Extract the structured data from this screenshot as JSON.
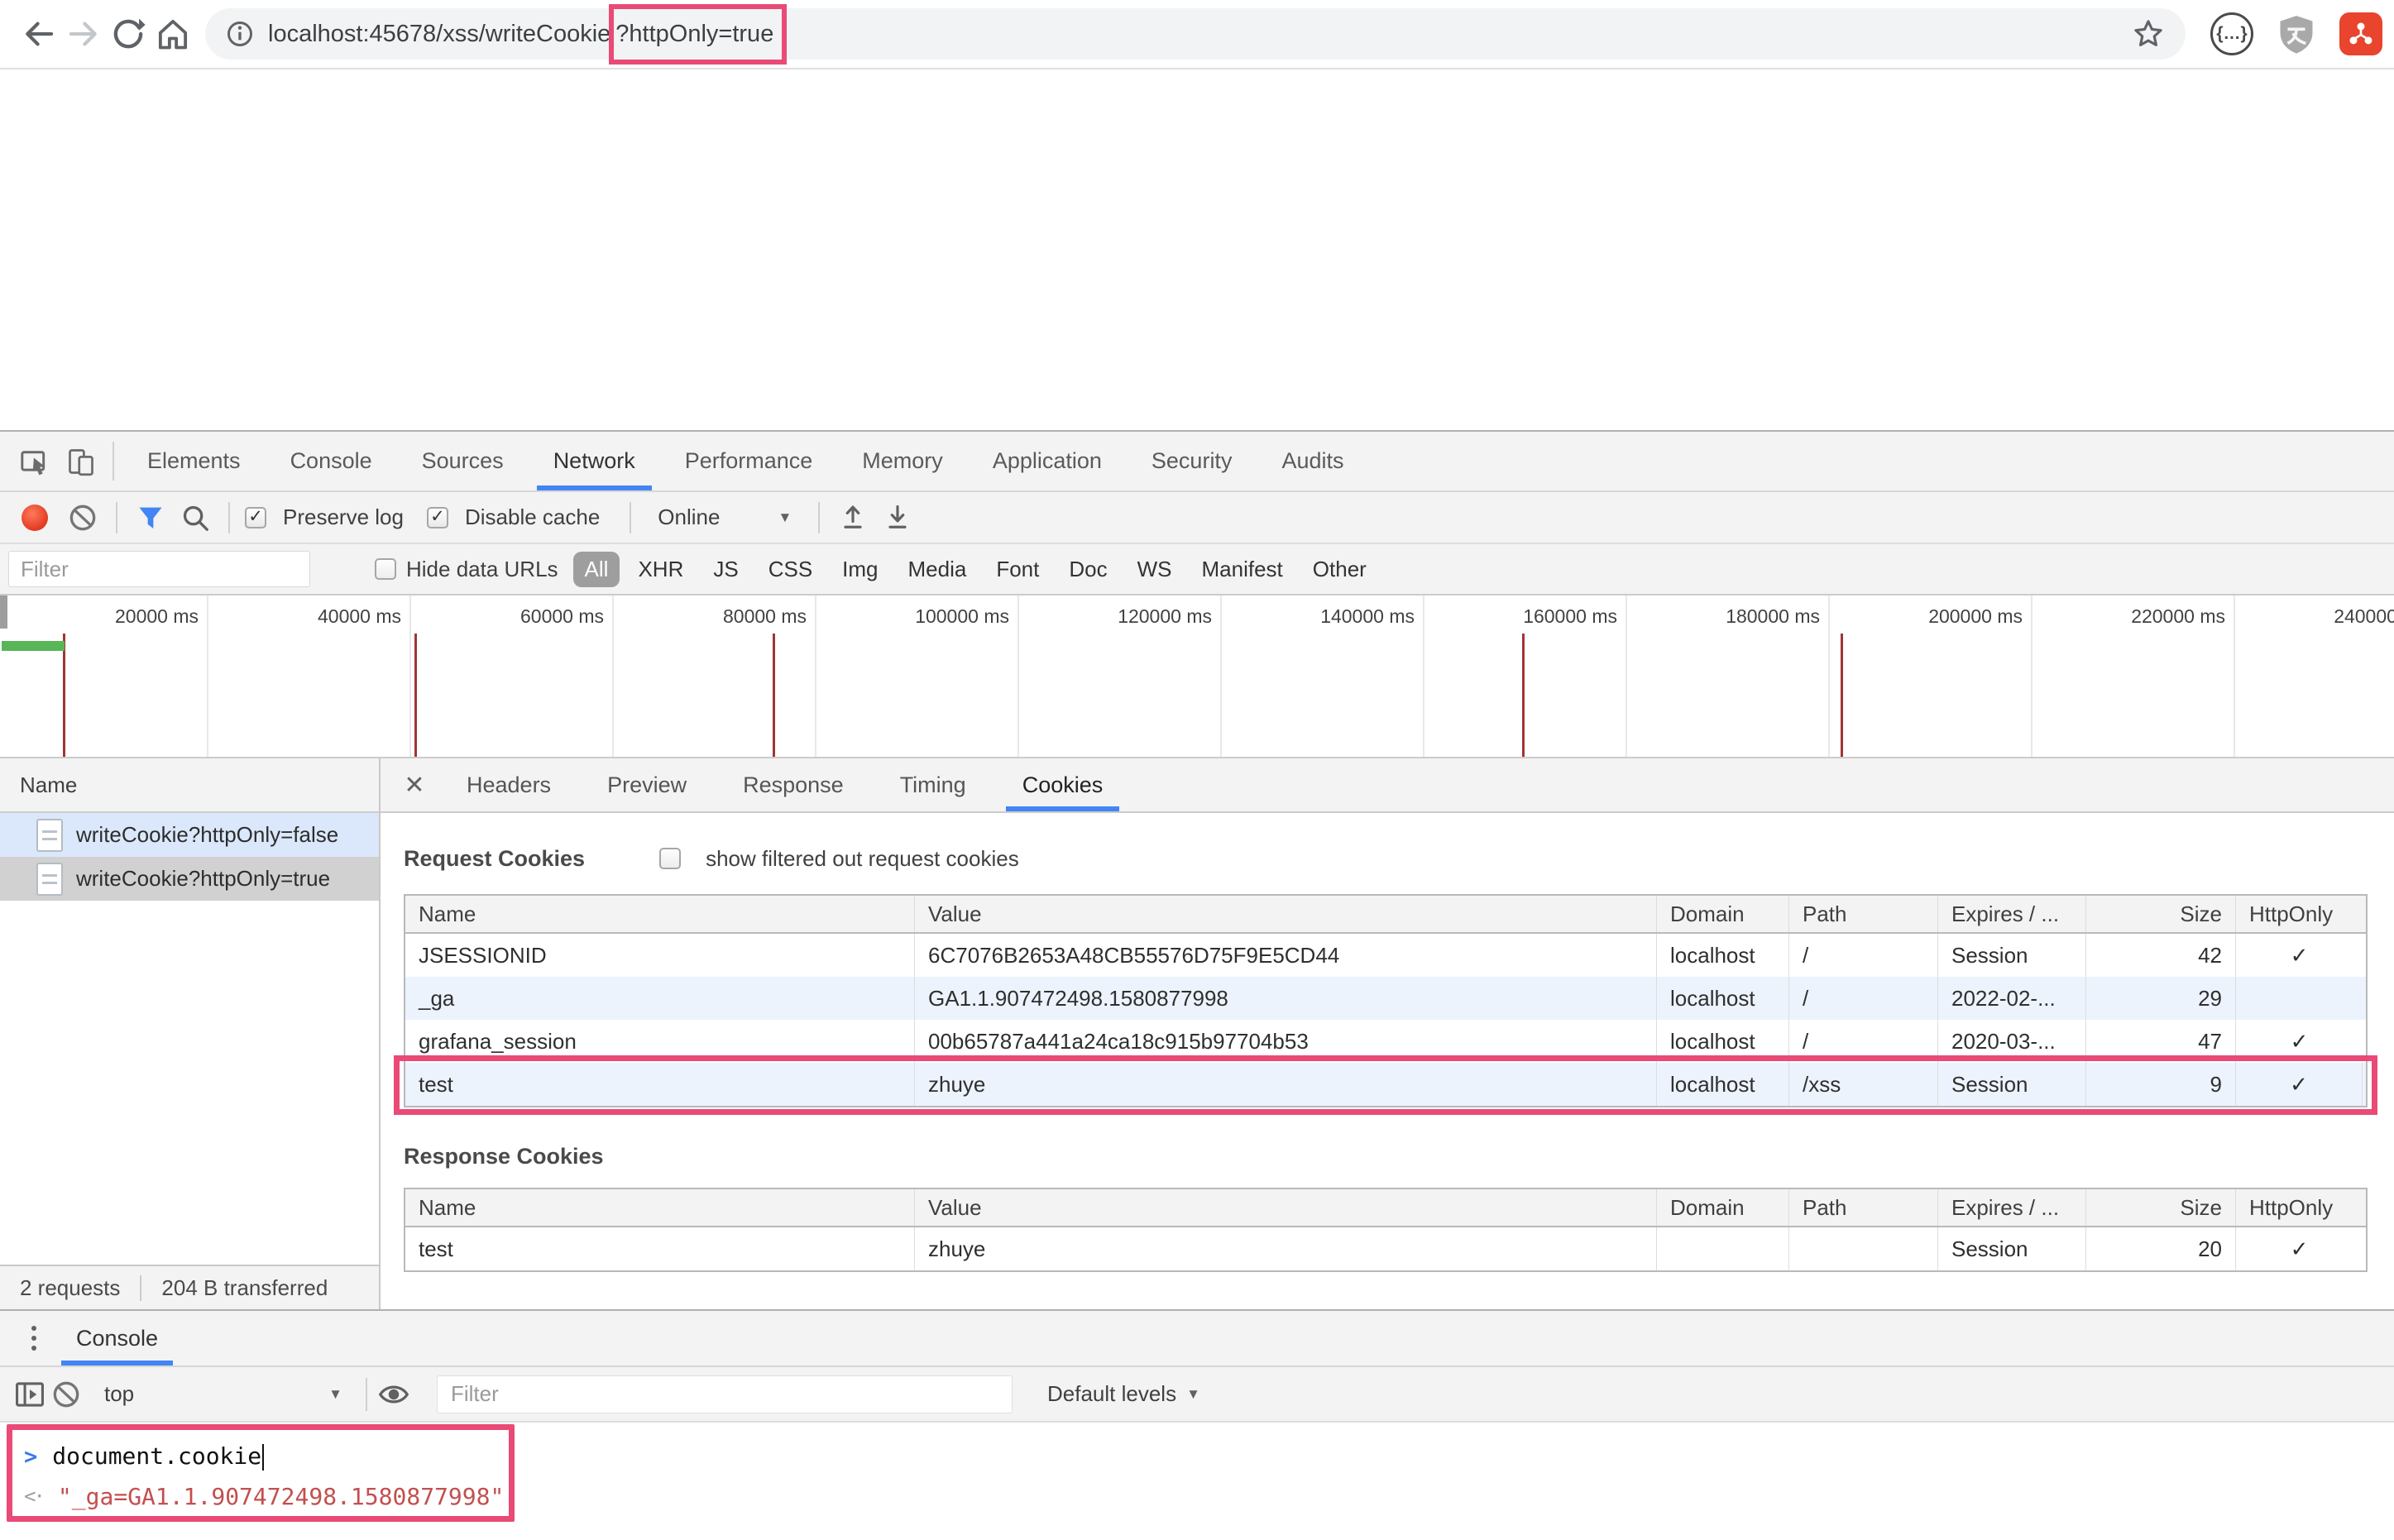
{
  "browser": {
    "url_base": "localhost:45678/xss/writeCookie",
    "url_query": "?httpOnly=true"
  },
  "devtools": {
    "main_tabs": [
      {
        "label": "Elements",
        "active": false
      },
      {
        "label": "Console",
        "active": false
      },
      {
        "label": "Sources",
        "active": false
      },
      {
        "label": "Network",
        "active": true
      },
      {
        "label": "Performance",
        "active": false
      },
      {
        "label": "Memory",
        "active": false
      },
      {
        "label": "Application",
        "active": false
      },
      {
        "label": "Security",
        "active": false
      },
      {
        "label": "Audits",
        "active": false
      }
    ],
    "network_toolbar": {
      "preserve_log": "Preserve log",
      "disable_cache": "Disable cache",
      "throttling": "Online"
    },
    "filter_bar": {
      "placeholder": "Filter",
      "hide_data_urls": "Hide data URLs",
      "chips": [
        {
          "label": "All",
          "active": true
        },
        {
          "label": "XHR",
          "active": false
        },
        {
          "label": "JS",
          "active": false
        },
        {
          "label": "CSS",
          "active": false
        },
        {
          "label": "Img",
          "active": false
        },
        {
          "label": "Media",
          "active": false
        },
        {
          "label": "Font",
          "active": false
        },
        {
          "label": "Doc",
          "active": false
        },
        {
          "label": "WS",
          "active": false
        },
        {
          "label": "Manifest",
          "active": false
        },
        {
          "label": "Other",
          "active": false
        }
      ]
    },
    "timeline": {
      "tick_interval_ms": 20000,
      "labels": [
        "20000 ms",
        "40000 ms",
        "60000 ms",
        "80000 ms",
        "100000 ms",
        "120000 ms",
        "140000 ms",
        "160000 ms",
        "180000 ms",
        "200000 ms",
        "220000 ms",
        "240000 ms"
      ],
      "load_events_ms": [
        5800,
        40500,
        75800,
        149800,
        181200
      ],
      "paint_bar_ms": [
        0,
        6200
      ]
    },
    "request_list": {
      "header": "Name",
      "rows": [
        {
          "name": "writeCookie?httpOnly=false",
          "state": "hover"
        },
        {
          "name": "writeCookie?httpOnly=true",
          "state": "selected"
        }
      ]
    },
    "details": {
      "tabs": [
        {
          "label": "Headers",
          "active": false
        },
        {
          "label": "Preview",
          "active": false
        },
        {
          "label": "Response",
          "active": false
        },
        {
          "label": "Timing",
          "active": false
        },
        {
          "label": "Cookies",
          "active": true
        }
      ],
      "request_cookies": {
        "title": "Request Cookies",
        "checkbox_label": "show filtered out request cookies",
        "columns": [
          "Name",
          "Value",
          "Domain",
          "Path",
          "Expires / ...",
          "Size",
          "HttpOnly"
        ],
        "rows": [
          {
            "name": "JSESSIONID",
            "value": "6C7076B2653A48CB55576D75F9E5CD44",
            "domain": "localhost",
            "path": "/",
            "expires": "Session",
            "size": "42",
            "http_only": true,
            "highlighted": false
          },
          {
            "name": "_ga",
            "value": "GA1.1.907472498.1580877998",
            "domain": "localhost",
            "path": "/",
            "expires": "2022-02-...",
            "size": "29",
            "http_only": false,
            "highlighted": false
          },
          {
            "name": "grafana_session",
            "value": "00b65787a441a24ca18c915b97704b53",
            "domain": "localhost",
            "path": "/",
            "expires": "2020-03-...",
            "size": "47",
            "http_only": true,
            "highlighted": false
          },
          {
            "name": "test",
            "value": "zhuye",
            "domain": "localhost",
            "path": "/xss",
            "expires": "Session",
            "size": "9",
            "http_only": true,
            "highlighted": true
          }
        ]
      },
      "response_cookies": {
        "title": "Response Cookies",
        "columns": [
          "Name",
          "Value",
          "Domain",
          "Path",
          "Expires / ...",
          "Size",
          "HttpOnly"
        ],
        "rows": [
          {
            "name": "test",
            "value": "zhuye",
            "domain": "",
            "path": "",
            "expires": "Session",
            "size": "20",
            "http_only": true,
            "highlighted": false
          }
        ]
      }
    },
    "summary": {
      "requests": "2 requests",
      "transferred": "204 B transferred"
    },
    "drawer": {
      "tab": "Console",
      "context": "top",
      "filter_placeholder": "Filter",
      "levels": "Default levels"
    },
    "console": {
      "input": "document.cookie",
      "result": "\"_ga=GA1.1.907472498.1580877998\""
    }
  },
  "icons": {
    "check": "✓",
    "close": "✕",
    "dropdown_arrow": "▼",
    "braces": "{…}",
    "prompt": ">",
    "result_arrow": "<·"
  },
  "colors": {
    "accent_blue": "#4285f4",
    "annotation_pink": "#e94a76",
    "record_red": "#e23a22",
    "console_string_red": "#c34f4f",
    "paint_green": "#58b558",
    "load_event_red": "#a03535"
  }
}
